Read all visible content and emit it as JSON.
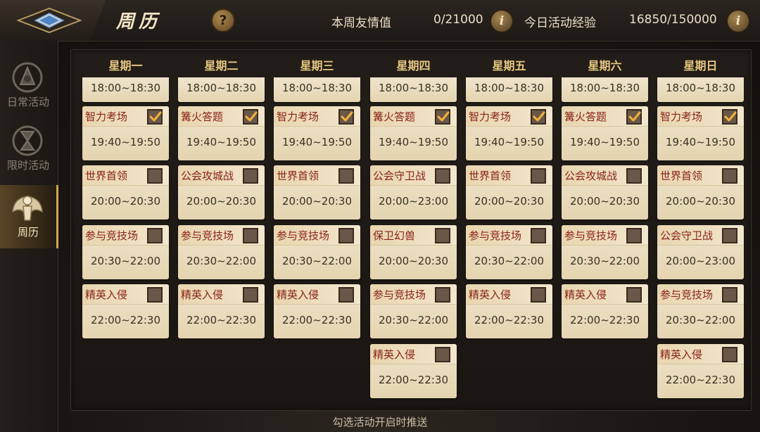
{
  "header": {
    "title": "周历",
    "help_icon": "?",
    "info_icon": "i",
    "friend_label": "本周友情值",
    "friend_value": "0/21000",
    "exp_label": "今日活动经验",
    "exp_value": "16850/150000"
  },
  "sidebar": {
    "items": [
      {
        "label": "日常活动",
        "icon": "guild-crest-icon",
        "active": false
      },
      {
        "label": "限时活动",
        "icon": "hourglass-icon",
        "active": false
      },
      {
        "label": "周历",
        "icon": "winged-crest-icon",
        "active": true
      }
    ]
  },
  "days": [
    {
      "name": "星期一",
      "top_time": "18:00~18:30",
      "events": [
        {
          "name": "智力考场",
          "time": "19:40~19:50",
          "checked": true
        },
        {
          "name": "世界首领",
          "time": "20:00~20:30",
          "checked": false
        },
        {
          "name": "参与竞技场",
          "time": "20:30~22:00",
          "checked": false
        },
        {
          "name": "精英入侵",
          "time": "22:00~22:30",
          "checked": false
        }
      ]
    },
    {
      "name": "星期二",
      "top_time": "18:00~18:30",
      "events": [
        {
          "name": "篝火答题",
          "time": "19:40~19:50",
          "checked": true
        },
        {
          "name": "公会攻城战",
          "time": "20:00~20:30",
          "checked": false
        },
        {
          "name": "参与竞技场",
          "time": "20:30~22:00",
          "checked": false
        },
        {
          "name": "精英入侵",
          "time": "22:00~22:30",
          "checked": false
        }
      ]
    },
    {
      "name": "星期三",
      "top_time": "18:00~18:30",
      "events": [
        {
          "name": "智力考场",
          "time": "19:40~19:50",
          "checked": true
        },
        {
          "name": "世界首领",
          "time": "20:00~20:30",
          "checked": false
        },
        {
          "name": "参与竞技场",
          "time": "20:30~22:00",
          "checked": false
        },
        {
          "name": "精英入侵",
          "time": "22:00~22:30",
          "checked": false
        }
      ]
    },
    {
      "name": "星期四",
      "top_time": "18:00~18:30",
      "events": [
        {
          "name": "篝火答题",
          "time": "19:40~19:50",
          "checked": true
        },
        {
          "name": "公会守卫战",
          "time": "20:00~23:00",
          "checked": false
        },
        {
          "name": "保卫幻兽",
          "time": "20:00~20:30",
          "checked": false
        },
        {
          "name": "参与竞技场",
          "time": "20:30~22:00",
          "checked": false
        },
        {
          "name": "精英入侵",
          "time": "22:00~22:30",
          "checked": false
        }
      ]
    },
    {
      "name": "星期五",
      "top_time": "18:00~18:30",
      "events": [
        {
          "name": "智力考场",
          "time": "19:40~19:50",
          "checked": true
        },
        {
          "name": "世界首领",
          "time": "20:00~20:30",
          "checked": false
        },
        {
          "name": "参与竞技场",
          "time": "20:30~22:00",
          "checked": false
        },
        {
          "name": "精英入侵",
          "time": "22:00~22:30",
          "checked": false
        }
      ]
    },
    {
      "name": "星期六",
      "top_time": "18:00~18:30",
      "events": [
        {
          "name": "篝火答题",
          "time": "19:40~19:50",
          "checked": true
        },
        {
          "name": "公会攻城战",
          "time": "20:00~20:30",
          "checked": false
        },
        {
          "name": "参与竞技场",
          "time": "20:30~22:00",
          "checked": false
        },
        {
          "name": "精英入侵",
          "time": "22:00~22:30",
          "checked": false
        }
      ]
    },
    {
      "name": "星期日",
      "top_time": "18:00~18:30",
      "events": [
        {
          "name": "智力考场",
          "time": "19:40~19:50",
          "checked": true
        },
        {
          "name": "世界首领",
          "time": "20:00~20:30",
          "checked": false
        },
        {
          "name": "公会守卫战",
          "time": "20:00~23:00",
          "checked": false
        },
        {
          "name": "参与竞技场",
          "time": "20:30~22:00",
          "checked": false
        },
        {
          "name": "精英入侵",
          "time": "22:00~22:30",
          "checked": false
        }
      ]
    }
  ],
  "footer": {
    "hint": "勾选活动开启时推送"
  },
  "colors": {
    "accent": "#d4a64d",
    "event_name": "#8a2218",
    "header_text": "#e8c780",
    "card_bg": "#efe4cc"
  }
}
